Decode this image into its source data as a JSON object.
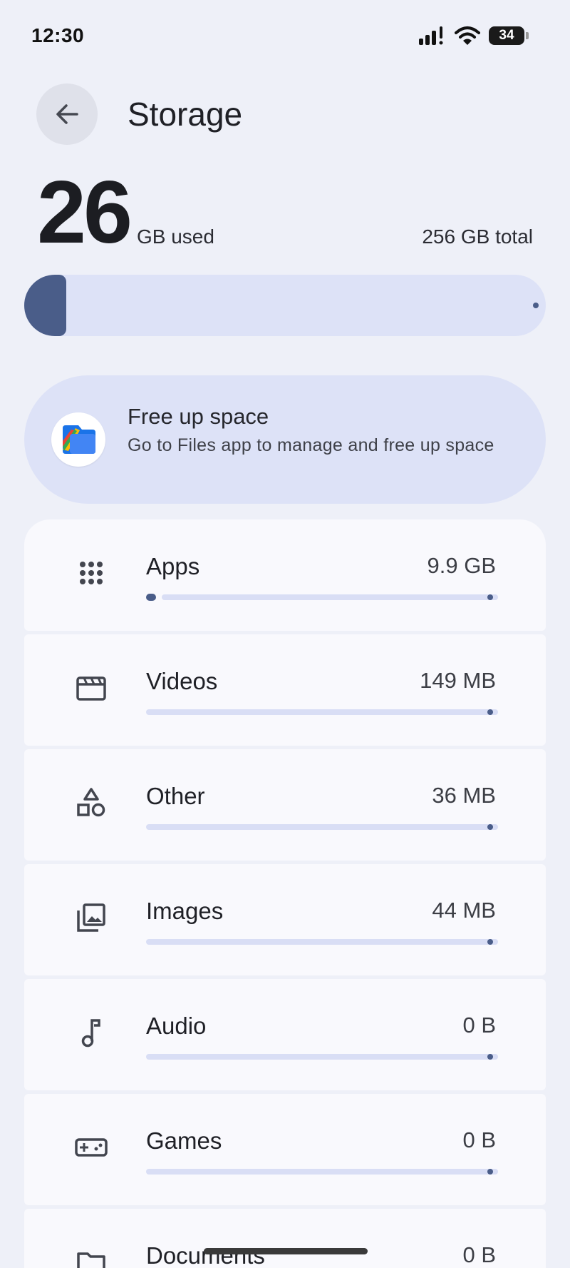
{
  "status_bar": {
    "time": "12:30",
    "battery": "34"
  },
  "header": {
    "title": "Storage"
  },
  "summary": {
    "used_value": "26",
    "used_unit": "GB used",
    "total": "256 GB total",
    "used_fraction": 0.1
  },
  "free_up": {
    "title": "Free up space",
    "subtitle": "Go to Files app to manage and free up space"
  },
  "categories": [
    {
      "label": "Apps",
      "size": "9.9 GB",
      "icon": "apps-grid-icon",
      "fraction": 0.04
    },
    {
      "label": "Videos",
      "size": "149 MB",
      "icon": "video-clapper-icon",
      "fraction": 0
    },
    {
      "label": "Other",
      "size": "36 MB",
      "icon": "shapes-icon",
      "fraction": 0
    },
    {
      "label": "Images",
      "size": "44 MB",
      "icon": "image-gallery-icon",
      "fraction": 0
    },
    {
      "label": "Audio",
      "size": "0 B",
      "icon": "music-note-icon",
      "fraction": 0
    },
    {
      "label": "Games",
      "size": "0 B",
      "icon": "gamepad-icon",
      "fraction": 0
    },
    {
      "label": "Documents",
      "size": "0 B",
      "icon": "folder-icon",
      "fraction": 0
    }
  ],
  "colors": {
    "accent": "#4a5d89",
    "track": "#dde2f7",
    "background": "#eef0f8",
    "card": "#f9f9fd"
  }
}
